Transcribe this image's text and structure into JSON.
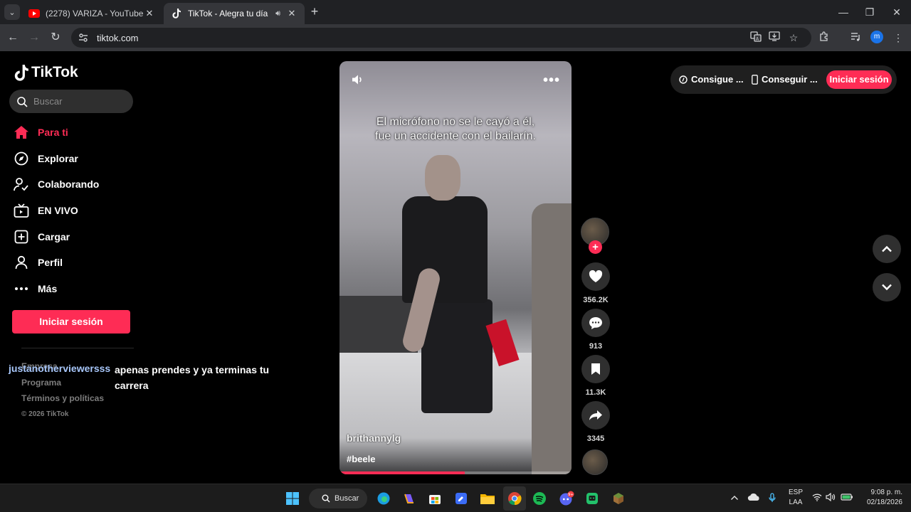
{
  "browser": {
    "tabs": [
      {
        "title": "(2278) VARIZA - YouTube",
        "favicon": "youtube-icon",
        "active": false
      },
      {
        "title": "TikTok - Alegra tu día",
        "favicon": "tiktok-icon",
        "active": true
      }
    ],
    "url": "tiktok.com",
    "profile_initial": "m"
  },
  "sidebar": {
    "brand": "TikTok",
    "search_placeholder": "Buscar",
    "nav": [
      {
        "label": "Para ti",
        "icon": "home-icon",
        "active": true
      },
      {
        "label": "Explorar",
        "icon": "compass-icon",
        "active": false
      },
      {
        "label": "Colaborando",
        "icon": "following-icon",
        "active": false
      },
      {
        "label": "EN VIVO",
        "icon": "live-tv-icon",
        "active": false
      },
      {
        "label": "Cargar",
        "icon": "upload-icon",
        "active": false
      },
      {
        "label": "Perfil",
        "icon": "profile-icon",
        "active": false
      },
      {
        "label": "Más",
        "icon": "more-dots-icon",
        "active": false
      }
    ],
    "login_label": "Iniciar sesión",
    "footer": {
      "company": "Empresa",
      "program": "Programa",
      "terms": "Términos y políticas",
      "copyright": "© 2026 TikTok"
    }
  },
  "overlay_comment": {
    "user": "justanotherviewersss",
    "text": "apenas prendes y ya terminas tu carrera"
  },
  "video": {
    "caption": "El micrófono no se le cayó a él, fue un accidente con el bailarín.",
    "author": "brithannylg",
    "hashtag": "#beele",
    "progress": 0.54
  },
  "actions": {
    "likes": "356.2K",
    "comments": "913",
    "saves": "11.3K",
    "shares": "3345"
  },
  "topbar": {
    "coins_label": "Consigue ...",
    "app_label": "Conseguir ...",
    "login_label": "Iniciar sesión"
  },
  "taskbar": {
    "search_label": "Buscar",
    "lang_line1": "ESP",
    "lang_line2": "LAA",
    "time": "9:08 p. m.",
    "date": "02/18/2026",
    "discord_badge": "9+"
  },
  "colors": {
    "accent": "#fe2c55",
    "background": "#000000"
  }
}
